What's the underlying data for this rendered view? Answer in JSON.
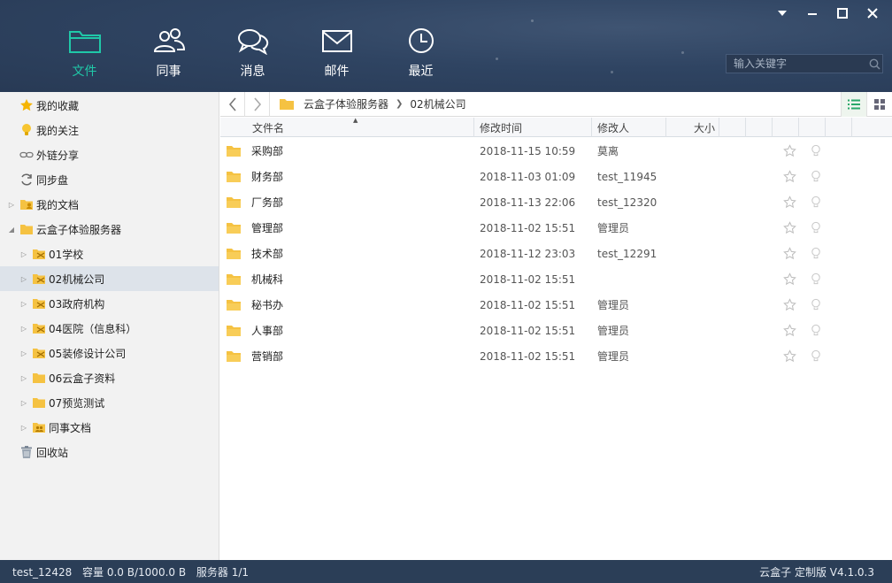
{
  "nav": {
    "items": [
      {
        "label": "文件",
        "icon": "folder-icon",
        "active": true
      },
      {
        "label": "同事",
        "icon": "colleagues-icon"
      },
      {
        "label": "消息",
        "icon": "chat-icon"
      },
      {
        "label": "邮件",
        "icon": "mail-icon"
      },
      {
        "label": "最近",
        "icon": "clock-icon"
      }
    ]
  },
  "search": {
    "placeholder": "输入关键字"
  },
  "sidebar": {
    "items": [
      {
        "label": "我的收藏",
        "icon": "star-icon"
      },
      {
        "label": "我的关注",
        "icon": "bulb-icon"
      },
      {
        "label": "外链分享",
        "icon": "link-icon"
      },
      {
        "label": "同步盘",
        "icon": "sync-icon"
      },
      {
        "label": "我的文档",
        "icon": "user-folder-icon"
      },
      {
        "label": "云盒子体验服务器",
        "icon": "folder-icon"
      },
      {
        "label": "01学校",
        "icon": "shared-folder-icon"
      },
      {
        "label": "02机械公司",
        "icon": "shared-folder-icon"
      },
      {
        "label": "03政府机构",
        "icon": "shared-folder-icon"
      },
      {
        "label": "04医院（信息科）",
        "icon": "shared-folder-icon"
      },
      {
        "label": "05装修设计公司",
        "icon": "shared-folder-icon"
      },
      {
        "label": "06云盒子资料",
        "icon": "folder-icon"
      },
      {
        "label": "07预览测试",
        "icon": "folder-icon"
      },
      {
        "label": "同事文档",
        "icon": "group-folder-icon"
      },
      {
        "label": "回收站",
        "icon": "trash-icon"
      }
    ]
  },
  "breadcrumb": {
    "items": [
      "云盒子体验服务器",
      "02机械公司"
    ]
  },
  "table": {
    "headers": {
      "name": "文件名",
      "time": "修改时间",
      "modifier": "修改人",
      "size": "大小"
    },
    "rows": [
      {
        "name": "采购部",
        "time": "2018-11-15 10:59",
        "modifier": "莫离"
      },
      {
        "name": "财务部",
        "time": "2018-11-03 01:09",
        "modifier": "test_11945"
      },
      {
        "name": "厂务部",
        "time": "2018-11-13 22:06",
        "modifier": "test_12320"
      },
      {
        "name": "管理部",
        "time": "2018-11-02 15:51",
        "modifier": "管理员"
      },
      {
        "name": "技术部",
        "time": "2018-11-12 23:03",
        "modifier": "test_12291"
      },
      {
        "name": "机械科",
        "time": "2018-11-02 15:51",
        "modifier": ""
      },
      {
        "name": "秘书办",
        "time": "2018-11-02 15:51",
        "modifier": "管理员"
      },
      {
        "name": "人事部",
        "time": "2018-11-02 15:51",
        "modifier": "管理员"
      },
      {
        "name": "营销部",
        "time": "2018-11-02 15:51",
        "modifier": "管理员"
      }
    ]
  },
  "status": {
    "user": "test_12428",
    "capacity": "容量 0.0 B/1000.0 B",
    "servers": "服务器 1/1",
    "version": "云盒子 定制版 V4.1.0.3"
  },
  "colors": {
    "accent": "#20c8a8",
    "header": "#2f4462",
    "folder": "#f5c242"
  }
}
